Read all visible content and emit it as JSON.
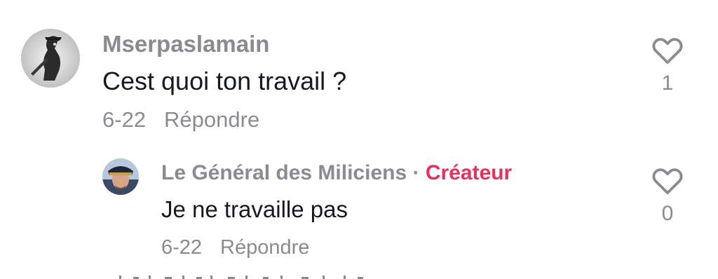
{
  "comments": [
    {
      "username": "Mserpaslamain",
      "text": "Cest quoi ton travail ?",
      "date": "6-22",
      "reply_label": "Répondre",
      "like_count": "1"
    }
  ],
  "replies": [
    {
      "username": "Le Général des Miliciens",
      "separator": "·",
      "badge": "Créateur",
      "text": "Je ne travaille pas",
      "date": "6-22",
      "reply_label": "Répondre",
      "like_count": "0"
    }
  ],
  "colors": {
    "creator_badge": "#e8305c",
    "secondary_text": "#8a8b91",
    "primary_text": "#161823"
  },
  "icons": {
    "like": "heart-outline-icon"
  }
}
